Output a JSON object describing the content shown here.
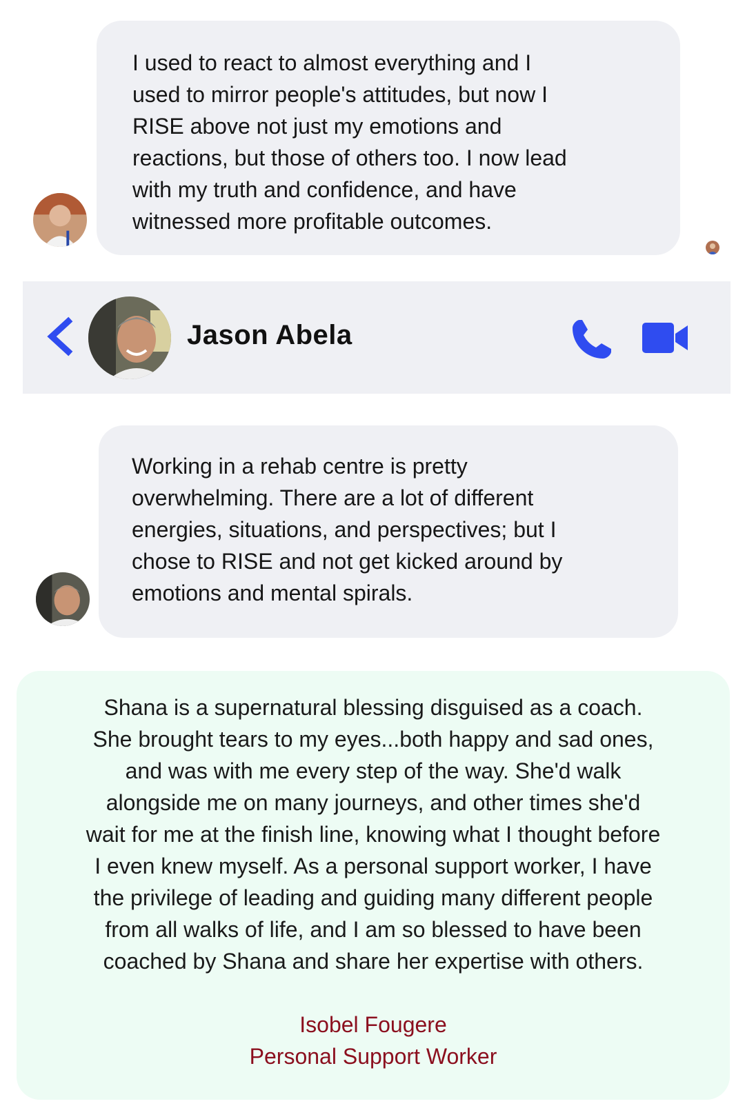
{
  "colors": {
    "accent": "#2f4cf0",
    "bubble_bg": "#eff0f4",
    "card_bg": "#edfcf4",
    "author_color": "#8b0f1e"
  },
  "messages": [
    {
      "text": " I used to react to almost everything and I\nused to mirror people's attitudes, but now I\nRISE above not just my emotions and\nreactions, but those of others too. I now lead\nwith my truth and confidence, and have\nwitnessed more profitable outcomes.",
      "avatar_icon": "sender-avatar"
    },
    {
      "text": "Working in a rehab centre is pretty\noverwhelming. There are a lot of different\nenergies, situations, and perspectives; but I\nchose to RISE and not get kicked around by\nemotions and mental spirals.",
      "avatar_icon": "sender-avatar"
    }
  ],
  "chat_header": {
    "contact_name": "Jason Abela",
    "back_icon": "chevron-left-icon",
    "call_icon": "phone-icon",
    "video_icon": "video-camera-icon"
  },
  "testimonial": {
    "quote": "Shana is a supernatural blessing disguised as a coach.\nShe brought tears to my eyes...both happy and sad ones,\nand was with me every step of the way. She'd walk\nalongside me on many journeys, and other times she'd\nwait for me at the finish line, knowing what I thought before\nI even knew myself. As a personal support worker, I have\nthe privilege of leading and guiding many different people\nfrom all walks of life, and I am so blessed to have been\ncoached by Shana and share her expertise with others.",
    "author": "Isobel Fougere",
    "role": "Personal Support Worker"
  }
}
